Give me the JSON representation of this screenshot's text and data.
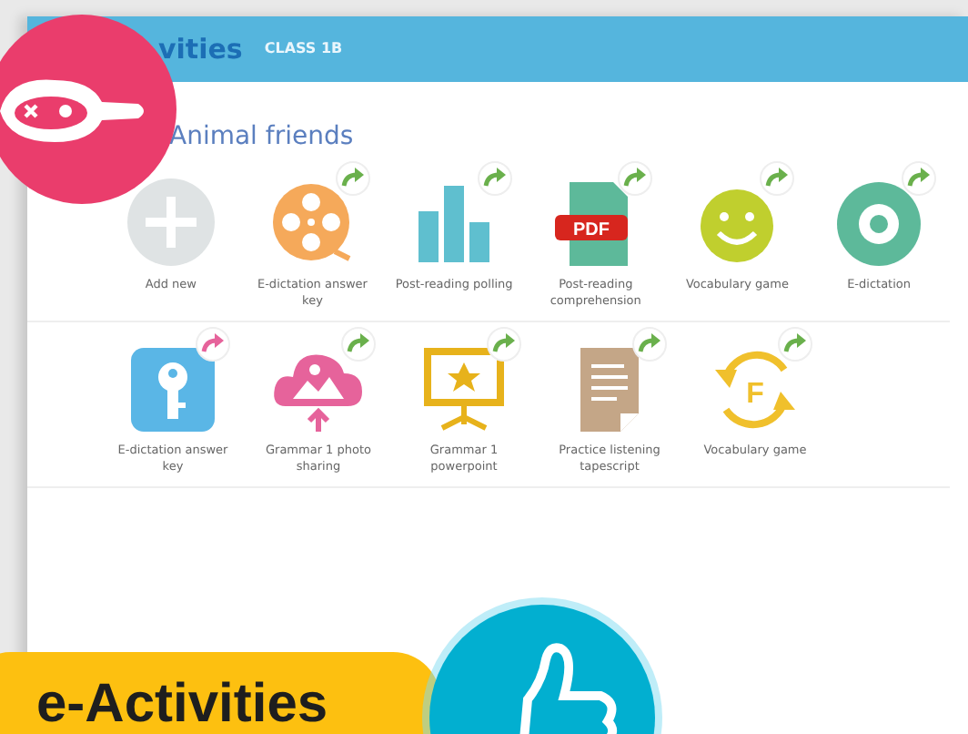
{
  "header": {
    "title": "vities",
    "class_label": "CLASS 1B"
  },
  "section": {
    "title": "Animal friends"
  },
  "rows": [
    [
      {
        "kind": "add",
        "label": "Add new"
      },
      {
        "kind": "film",
        "label": "E-dictation answer key"
      },
      {
        "kind": "chart",
        "label": "Post-reading polling"
      },
      {
        "kind": "pdf",
        "label": "Post-reading comprehension",
        "badge_text": "PDF"
      },
      {
        "kind": "smiley",
        "label": "Vocabulary game"
      },
      {
        "kind": "ring",
        "label": "E-dictation"
      }
    ],
    [
      {
        "kind": "key",
        "label": "E-dictation answer key"
      },
      {
        "kind": "cloud",
        "label": "Grammar 1 photo sharing"
      },
      {
        "kind": "easel",
        "label": "Grammar 1 powerpoint"
      },
      {
        "kind": "doc",
        "label": "Practice listening tapescript"
      },
      {
        "kind": "cycle",
        "label": "Vocabulary game",
        "badge_text": "F"
      }
    ]
  ],
  "promo": {
    "label": "e-Activities"
  }
}
